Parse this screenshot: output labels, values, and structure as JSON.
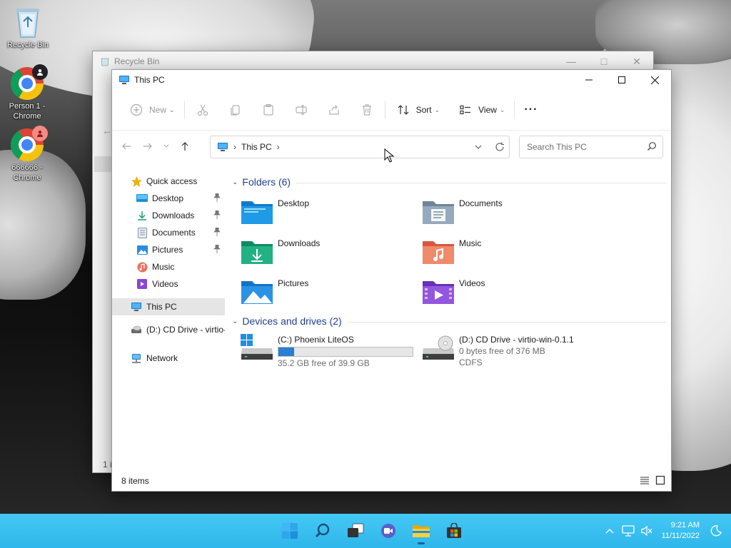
{
  "desktop": {
    "icons": [
      {
        "label": "Recycle Bin"
      },
      {
        "label": "Person 1 - Chrome"
      },
      {
        "label": "666666 - Chrome"
      }
    ]
  },
  "recycle_window": {
    "title": "Recycle Bin",
    "status_partial": "1 i"
  },
  "explorer": {
    "title": "This PC",
    "window_controls": [
      "minimize",
      "maximize",
      "close"
    ],
    "command_bar": {
      "new_label": "New",
      "sort_label": "Sort",
      "view_label": "View",
      "more_label": "···"
    },
    "address": {
      "location": "This PC",
      "separator": "›"
    },
    "search": {
      "placeholder": "Search This PC"
    },
    "sidebar": {
      "quick_access": "Quick access",
      "items": [
        {
          "label": "Desktop",
          "pinned": true
        },
        {
          "label": "Downloads",
          "pinned": true
        },
        {
          "label": "Documents",
          "pinned": true
        },
        {
          "label": "Pictures",
          "pinned": true
        },
        {
          "label": "Music",
          "pinned": false
        },
        {
          "label": "Videos",
          "pinned": false
        }
      ],
      "this_pc": "This PC",
      "cd_drive": "(D:) CD Drive - virtio-",
      "network": "Network"
    },
    "folders_header": "Folders (6)",
    "folders": [
      {
        "label": "Desktop"
      },
      {
        "label": "Documents"
      },
      {
        "label": "Downloads"
      },
      {
        "label": "Music"
      },
      {
        "label": "Pictures"
      },
      {
        "label": "Videos"
      }
    ],
    "drives_header": "Devices and drives (2)",
    "drives": [
      {
        "name": "(C:) Phoenix LiteOS",
        "free_text": "35.2 GB free of 39.9 GB",
        "used_fraction": 0.118
      },
      {
        "name": "(D:) CD Drive - virtio-win-0.1.1",
        "free_text": "0 bytes free of 376 MB",
        "filesystem": "CDFS"
      }
    ],
    "status": {
      "item_count": "8 items"
    }
  },
  "taskbar": {
    "apps": [
      "start-icon",
      "search-icon",
      "task-view-icon",
      "chat-icon",
      "file-explorer-icon",
      "store-icon"
    ],
    "clock": {
      "time": "9:21 AM",
      "date": "11/11/2022"
    }
  },
  "colors": {
    "taskbar": "#3ec0f0",
    "accent_blue": "#2a7fd1",
    "group_header": "#1f3f8f"
  }
}
